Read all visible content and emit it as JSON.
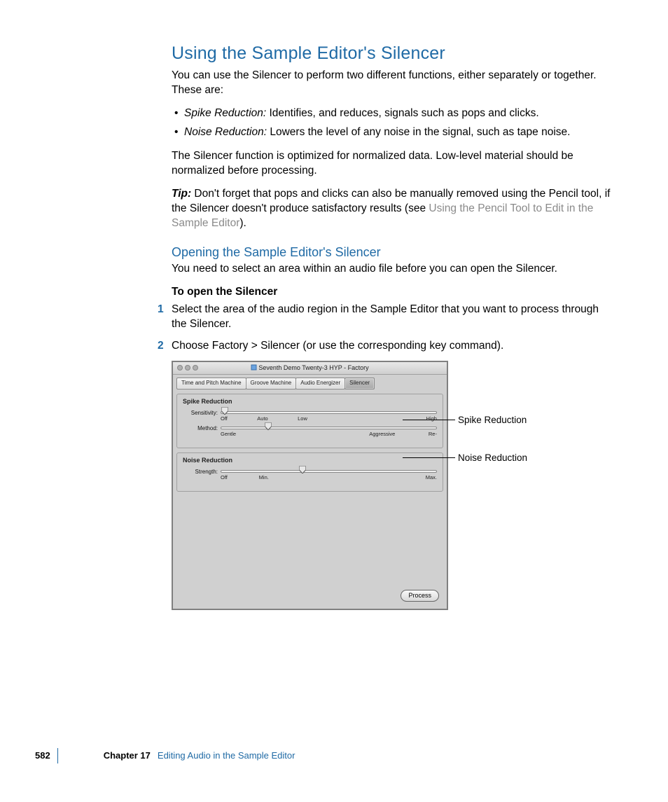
{
  "heading1": "Using the Sample Editor's Silencer",
  "intro": "You can use the Silencer to perform two different functions, either separately or together. These are:",
  "bullets": [
    {
      "term": "Spike Reduction:",
      "desc": "  Identifies, and reduces, signals such as pops and clicks."
    },
    {
      "term": "Noise Reduction:",
      "desc": "  Lowers the level of any noise in the signal, such as tape noise."
    }
  ],
  "after_bullets": "The Silencer function is optimized for normalized data. Low-level material should be normalized before processing.",
  "tip": {
    "lead": "Tip:",
    "body1": "  Don't forget that pops and clicks can also be manually removed using the Pencil tool, if the Silencer doesn't produce satisfactory results (see ",
    "link": "Using the Pencil Tool to Edit in the Sample Editor",
    "close": ")."
  },
  "heading2": "Opening the Sample Editor's Silencer",
  "h2_body": "You need to select an area within an audio file before you can open the Silencer.",
  "subhead": "To open the Silencer",
  "steps": [
    {
      "num": "1",
      "text": "Select the area of the audio region in the Sample Editor that you want to process through the Silencer."
    },
    {
      "num": "2",
      "text": "Choose Factory > Silencer (or use the corresponding key command)."
    }
  ],
  "win": {
    "title": "Seventh Demo Twenty-3 HYP - Factory",
    "tabs": [
      "Time and Pitch Machine",
      "Groove Machine",
      "Audio Energizer",
      "Silencer"
    ],
    "active_tab": 3,
    "group1": {
      "title": "Spike Reduction",
      "row1": {
        "label": "Sensitivity:",
        "ticks": [
          "Off",
          "Auto",
          "Low",
          "",
          "",
          "",
          "High"
        ]
      },
      "row2": {
        "label": "Method:",
        "ticks": [
          "Gentle",
          "",
          "",
          "",
          "Aggressive",
          "Re-"
        ]
      }
    },
    "group2": {
      "title": "Noise Reduction",
      "row1": {
        "label": "Strength:",
        "ticks": [
          "Off",
          "Min.",
          "",
          "",
          "",
          "",
          "Max."
        ]
      }
    },
    "button": "Process"
  },
  "callouts": {
    "c1": "Spike Reduction",
    "c2": "Noise Reduction"
  },
  "footer": {
    "page": "582",
    "chapter": "Chapter 17",
    "title": "Editing Audio in the Sample Editor"
  }
}
